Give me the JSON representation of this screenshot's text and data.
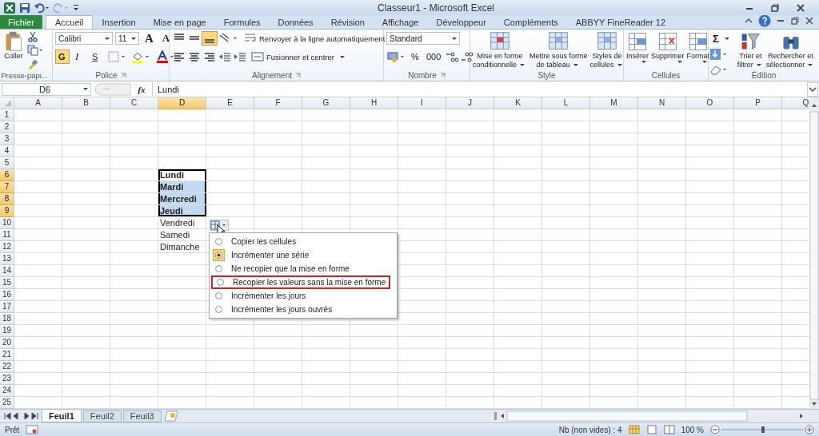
{
  "window": {
    "title": "Classeur1 - Microsoft Excel"
  },
  "ribbon_tabs": [
    {
      "label": "Fichier",
      "kind": "file",
      "selected": false
    },
    {
      "label": "Accueil",
      "kind": "tab",
      "selected": true
    },
    {
      "label": "Insertion",
      "kind": "tab",
      "selected": false
    },
    {
      "label": "Mise en page",
      "kind": "tab",
      "selected": false
    },
    {
      "label": "Formules",
      "kind": "tab",
      "selected": false
    },
    {
      "label": "Données",
      "kind": "tab",
      "selected": false
    },
    {
      "label": "Révision",
      "kind": "tab",
      "selected": false
    },
    {
      "label": "Affichage",
      "kind": "tab",
      "selected": false
    },
    {
      "label": "Développeur",
      "kind": "tab",
      "selected": false
    },
    {
      "label": "Compléments",
      "kind": "tab",
      "selected": false
    },
    {
      "label": "ABBYY FineReader 12",
      "kind": "tab",
      "selected": false
    }
  ],
  "ribbon": {
    "clipboard": {
      "label": "Presse-papi...",
      "paste": "Coller"
    },
    "font": {
      "label": "Police",
      "family": "Calibri",
      "size": "11",
      "grow": "A",
      "shrink": "A",
      "styles": [
        {
          "label": "G",
          "on": true
        },
        {
          "label": "I",
          "on": false
        },
        {
          "label": "S",
          "on": false
        }
      ]
    },
    "alignment": {
      "label": "Alignement",
      "wrap": "Renvoyer à la ligne automatiquement",
      "merge": "Fusionner et centrer",
      "bottom_align_on": true
    },
    "number": {
      "label": "Nombre",
      "format": "Standard",
      "percent": "%",
      "thousands": "000"
    },
    "style": {
      "label": "Style",
      "buttons": [
        {
          "lines": [
            "Mise en forme",
            "conditionnelle"
          ]
        },
        {
          "lines": [
            "Mettre sous forme",
            "de tableau"
          ]
        },
        {
          "lines": [
            "Styles de",
            "cellules"
          ]
        }
      ]
    },
    "cells": {
      "label": "Cellules",
      "buttons": [
        {
          "lines": [
            "Insérer"
          ]
        },
        {
          "lines": [
            "Supprimer"
          ]
        },
        {
          "lines": [
            "Format"
          ]
        }
      ]
    },
    "editing": {
      "label": "Édition",
      "sum": "Σ",
      "buttons": [
        {
          "lines": [
            "Trier et",
            "filtrer"
          ]
        },
        {
          "lines": [
            "Rechercher et",
            "sélectionner"
          ]
        }
      ]
    }
  },
  "formula_bar": {
    "name_box": "D6",
    "fx": "fx",
    "value": "Lundi"
  },
  "sheet": {
    "columns": [
      {
        "label": "A",
        "selected": false
      },
      {
        "label": "B",
        "selected": false
      },
      {
        "label": "C",
        "selected": false
      },
      {
        "label": "D",
        "selected": true
      },
      {
        "label": "E",
        "selected": false
      },
      {
        "label": "F",
        "selected": false
      },
      {
        "label": "G",
        "selected": false
      },
      {
        "label": "H",
        "selected": false
      },
      {
        "label": "I",
        "selected": false
      },
      {
        "label": "J",
        "selected": false
      },
      {
        "label": "K",
        "selected": false
      },
      {
        "label": "L",
        "selected": false
      },
      {
        "label": "M",
        "selected": false
      },
      {
        "label": "N",
        "selected": false
      },
      {
        "label": "O",
        "selected": false
      },
      {
        "label": "P",
        "selected": false
      },
      {
        "label": "Q",
        "selected": false
      }
    ],
    "rows": [
      {
        "header": "1",
        "selected": false
      },
      {
        "header": "2",
        "selected": false
      },
      {
        "header": "3",
        "selected": false
      },
      {
        "header": "4",
        "selected": false
      },
      {
        "header": "5",
        "selected": false
      },
      {
        "header": "6",
        "selected": true,
        "cells": [
          {},
          {},
          {},
          {
            "text": "Lundi",
            "bold": true,
            "selected": true,
            "active": true
          }
        ]
      },
      {
        "header": "7",
        "selected": true,
        "cells": [
          {},
          {},
          {},
          {
            "text": "Mardi",
            "bold": true,
            "selected": true,
            "active": false
          }
        ]
      },
      {
        "header": "8",
        "selected": true,
        "cells": [
          {},
          {},
          {},
          {
            "text": "Mercredi",
            "bold": true,
            "selected": true,
            "active": false
          }
        ]
      },
      {
        "header": "9",
        "selected": true,
        "cells": [
          {},
          {},
          {},
          {
            "text": "Jeudi",
            "bold": true,
            "selected": true,
            "active": false
          }
        ]
      },
      {
        "header": "10",
        "selected": false,
        "cells": [
          {},
          {},
          {},
          {
            "text": "Vendredi",
            "bold": false,
            "selected": false,
            "active": false
          }
        ]
      },
      {
        "header": "11",
        "selected": false,
        "cells": [
          {},
          {},
          {},
          {
            "text": "Samedi",
            "bold": false,
            "selected": false,
            "active": false
          }
        ]
      },
      {
        "header": "12",
        "selected": false,
        "cells": [
          {},
          {},
          {},
          {
            "text": "Dimanche",
            "bold": false,
            "selected": false,
            "active": false
          }
        ]
      },
      {
        "header": "13",
        "selected": false
      },
      {
        "header": "14",
        "selected": false
      },
      {
        "header": "15",
        "selected": false
      },
      {
        "header": "16",
        "selected": false
      },
      {
        "header": "17",
        "selected": false
      },
      {
        "header": "18",
        "selected": false
      },
      {
        "header": "19",
        "selected": false
      },
      {
        "header": "20",
        "selected": false
      },
      {
        "header": "21",
        "selected": false
      },
      {
        "header": "22",
        "selected": false
      },
      {
        "header": "23",
        "selected": false
      },
      {
        "header": "24",
        "selected": false
      },
      {
        "header": "25",
        "selected": false
      }
    ]
  },
  "fill_options": {
    "items": [
      {
        "label": "Copier les cellules",
        "selected": false,
        "highlighted": false
      },
      {
        "label": "Incrémenter une série",
        "selected": true,
        "highlighted": false
      },
      {
        "label": "Ne recopier que la mise en forme",
        "selected": false,
        "highlighted": false
      },
      {
        "label": "Recopier les valeurs sans la mise en forme",
        "selected": false,
        "highlighted": true
      },
      {
        "label": "Incrémenter les jours",
        "selected": false,
        "highlighted": false
      },
      {
        "label": "Incrémenter les jours ouvrés",
        "selected": false,
        "highlighted": false
      }
    ]
  },
  "sheet_tabs": [
    {
      "label": "Feuil1",
      "selected": true
    },
    {
      "label": "Feuil2",
      "selected": false
    },
    {
      "label": "Feuil3",
      "selected": false
    }
  ],
  "status_bar": {
    "mode": "Prêt",
    "count": "Nb (non vides) : 4",
    "zoom": "100 %",
    "zoom_slider": {
      "level": 0.5
    }
  }
}
